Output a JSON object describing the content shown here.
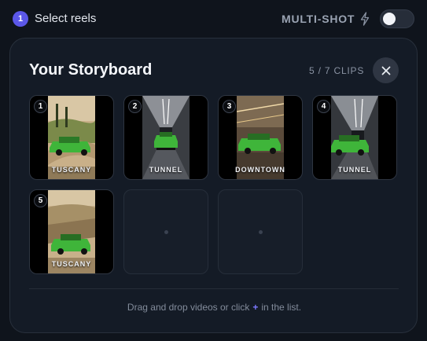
{
  "header": {
    "step_number": "1",
    "step_title": "Select reels",
    "multishot_label": "MULTI-SHOT",
    "multishot_enabled": false,
    "accent_color": "#5b57e8"
  },
  "storyboard": {
    "title": "Your Storyboard",
    "clip_count": "5 / 7 CLIPS",
    "close_icon": "close-icon",
    "clips": [
      {
        "number": "1",
        "label": "TUSCANY"
      },
      {
        "number": "2",
        "label": "TUNNEL"
      },
      {
        "number": "3",
        "label": "DOWNTOWN"
      },
      {
        "number": "4",
        "label": "TUNNEL"
      },
      {
        "number": "5",
        "label": "TUSCANY"
      }
    ],
    "empty_slots": 2,
    "hint_before": "Drag and drop videos or click",
    "hint_plus": "+",
    "hint_after": "in the list."
  }
}
